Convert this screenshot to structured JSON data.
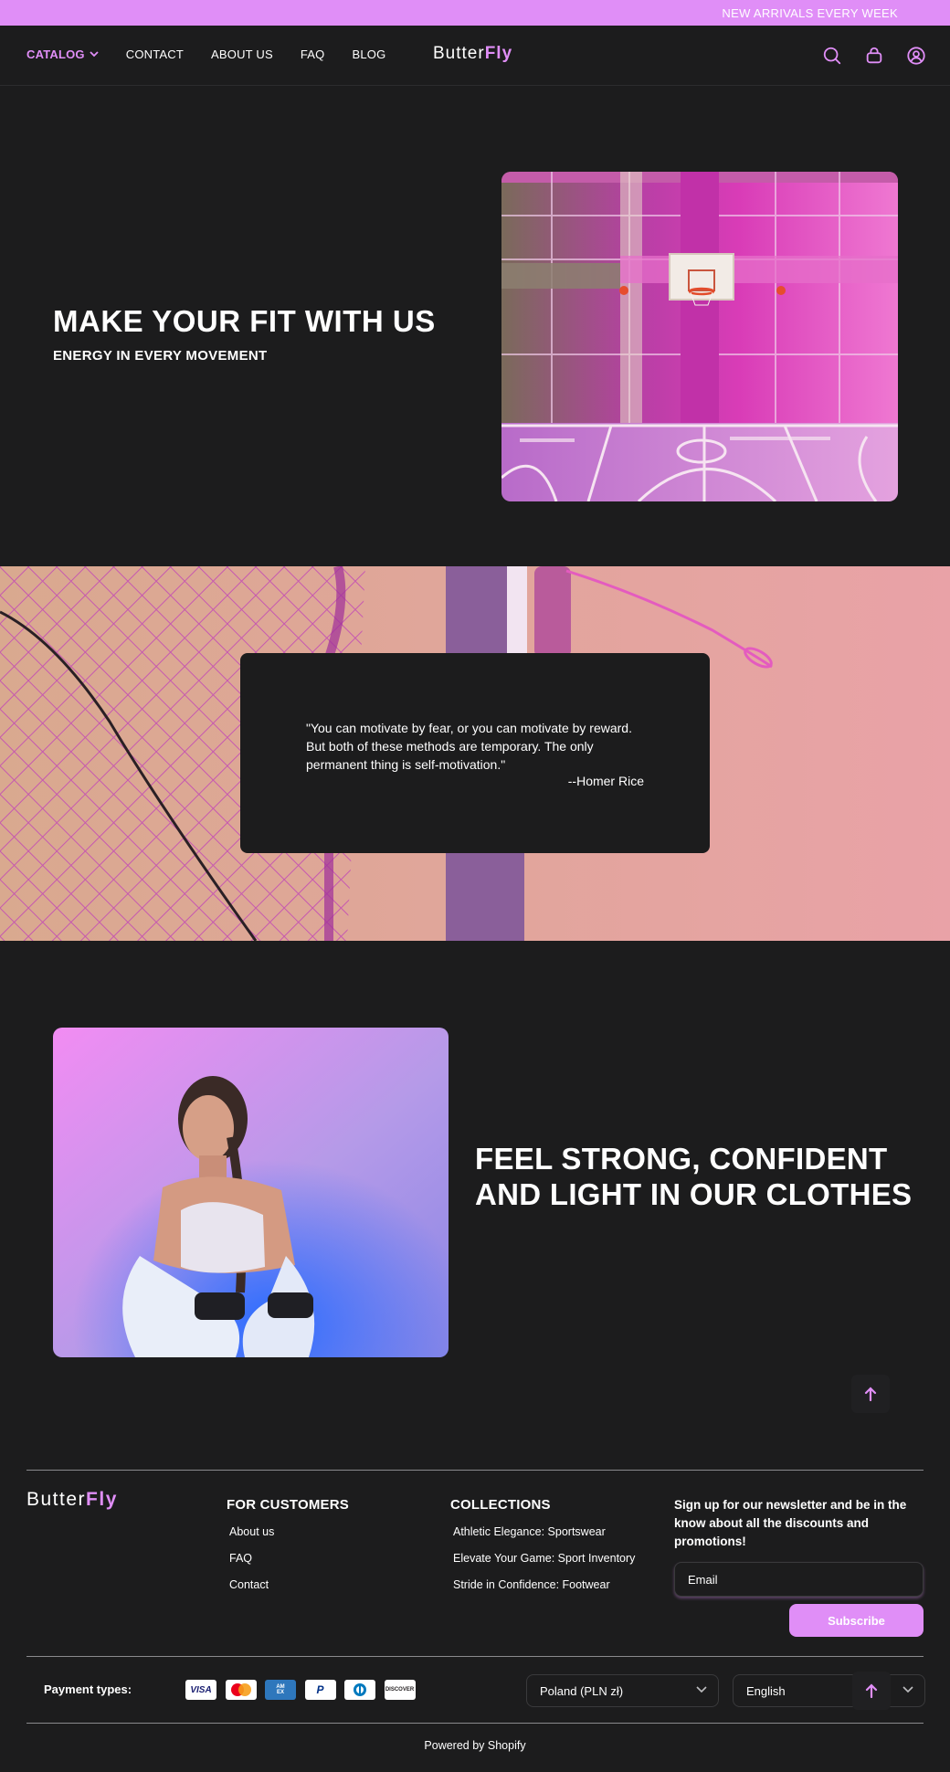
{
  "announcement": "NEW ARRIVALS EVERY WEEK",
  "nav": {
    "items": [
      "CATALOG",
      "CONTACT",
      "ABOUT US",
      "FAQ",
      "BLOG"
    ]
  },
  "brand": {
    "part1": "Butter",
    "part2": "Fly"
  },
  "hero": {
    "title": "MAKE YOUR FIT WITH US",
    "subtitle": "ENERGY IN EVERY MOVEMENT"
  },
  "quote": {
    "text": "\"You can motivate by fear, or you can motivate by reward. But both of these methods are temporary. The only permanent thing is self-motivation.\"",
    "author": "--Homer Rice"
  },
  "feature": {
    "title": "FEEL STRONG, CONFIDENT AND LIGHT IN OUR CLOTHES"
  },
  "footer": {
    "customers": {
      "title": "FOR CUSTOMERS",
      "links": [
        "About us",
        "FAQ",
        "Contact"
      ]
    },
    "collections": {
      "title": "COLLECTIONS",
      "links": [
        "Athletic Elegance: Sportswear",
        "Elevate Your Game: Sport Inventory",
        "Stride in Confidence: Footwear"
      ]
    },
    "newsletter": {
      "title": "Sign up for our newsletter and be in the know about all the discounts and promotions!",
      "placeholder": "Email",
      "button": "Subscribe"
    },
    "payment_label": "Payment types:",
    "payment_cards": {
      "visa": "VISA",
      "amex_top": "AM",
      "amex_bottom": "EX",
      "paypal": "P",
      "discover": "DISCOVER"
    },
    "country": "Poland (PLN zł)",
    "language": "English",
    "powered": "Powered by Shopify"
  },
  "colors": {
    "accent": "#e08ef7",
    "background": "#1c1c1d"
  },
  "icons": [
    "search-icon",
    "bag-icon",
    "account-icon",
    "arrow-up-icon",
    "chevron-down-icon"
  ]
}
